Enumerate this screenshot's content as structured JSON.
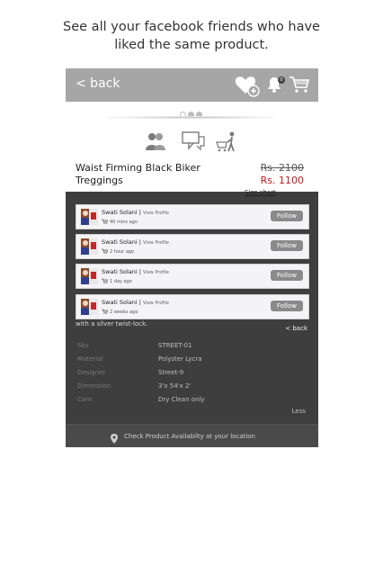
{
  "caption": {
    "line1": "See all your facebook friends who have",
    "line2": "liked the same product."
  },
  "topbar": {
    "back_label": "< back",
    "cart_badge": "0",
    "icons": [
      "heart-plus-icon",
      "bell-icon",
      "cart-icon"
    ]
  },
  "carousel": {
    "dots": 3,
    "active_dot": 0
  },
  "actions": {
    "icons": [
      "friends-icon",
      "chat-icon",
      "shopper-cart-icon"
    ]
  },
  "product": {
    "name_line1": "Waist Firming Black Biker",
    "name_line2": "Treggings",
    "original_price": "Rs. 2100",
    "sale_price": "Rs. 1100",
    "size_chart": "Size chart"
  },
  "details": {
    "description_end": "with a silver twist-lock.",
    "back_label": "< back",
    "specs": [
      {
        "label": "Sku",
        "value": "STREET-01"
      },
      {
        "label": "Material",
        "value": "Polyster Lycra"
      },
      {
        "label": "Designer",
        "value": "Street-9"
      },
      {
        "label": "Dimension",
        "value": "3'x 54'x 2'"
      },
      {
        "label": "Care",
        "value": "Dry Clean only"
      }
    ],
    "less_label": "Less",
    "availability": "Check Product Availabilty at your location"
  },
  "likes": [
    {
      "name": "Swati Solani",
      "sep": " | ",
      "view_profile": "View Profile",
      "time": "40 mins ago",
      "follow": "Follow"
    },
    {
      "name": "Swati Solani",
      "sep": " | ",
      "view_profile": "View Profile",
      "time": "2 hour ago",
      "follow": "Follow"
    },
    {
      "name": "Swati Solani",
      "sep": " | ",
      "view_profile": "View Profile",
      "time": "1 day ago",
      "follow": "Follow"
    },
    {
      "name": "Swati Solani",
      "sep": " | ",
      "view_profile": "View Profile",
      "time": "2 weeks ago",
      "follow": "Follow"
    }
  ],
  "colors": {
    "topbar": "#a6a6a6",
    "overlay": "#3e3e3e",
    "sale_price": "#c7161d",
    "follow_button": "#8a8a8a"
  }
}
